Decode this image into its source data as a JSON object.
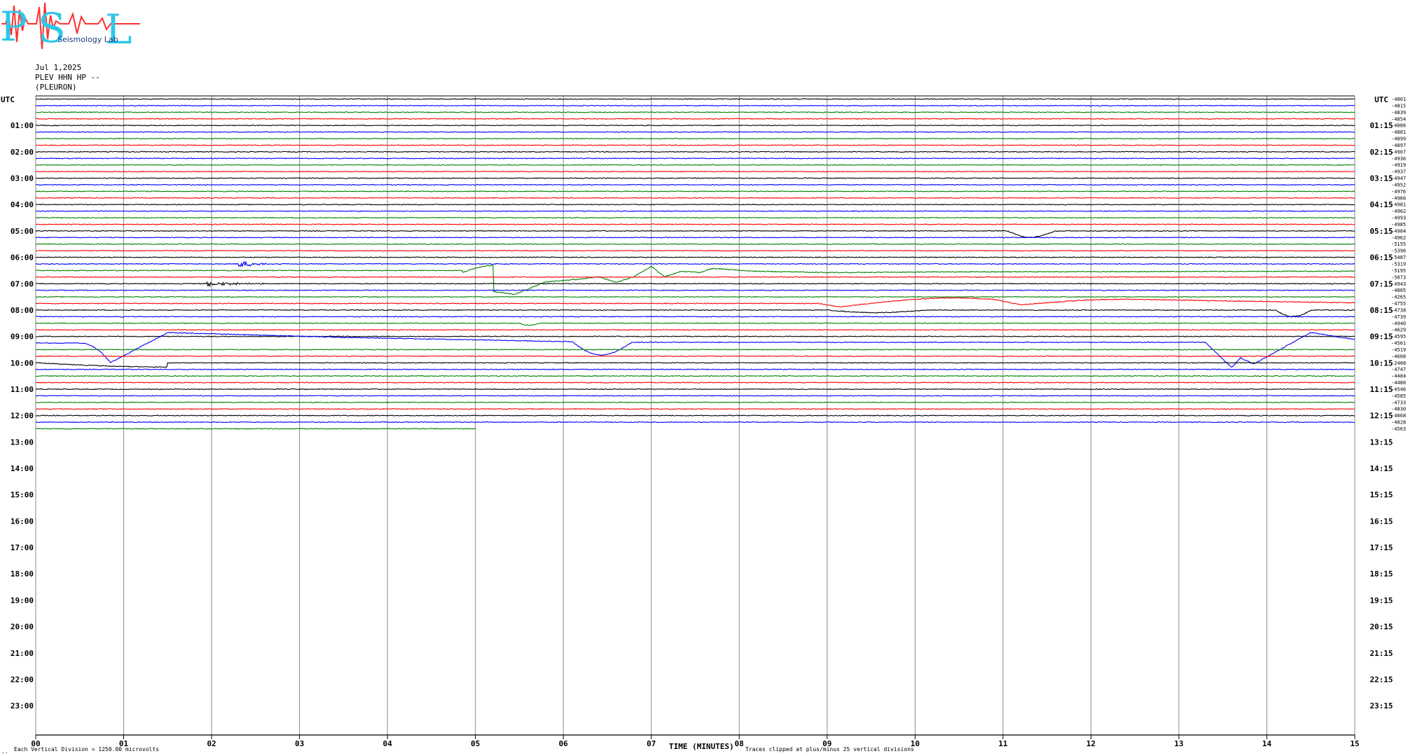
{
  "header": {
    "logo_text": "PSL",
    "logo_subtitle": "Seismology Lab",
    "date": "Jul 1,2025",
    "channel": "PLEV HHN HP --",
    "station": "(PLEURON)"
  },
  "footer": {
    "scale_note": "Each Vertical Division = 1250.00 microvolts",
    "clip_note": "Traces clipped at plus/minus 25 vertical divisions",
    "corner_mark": ".."
  },
  "chart_data": {
    "type": "line",
    "title": "",
    "xlabel": "TIME (MINUTES)",
    "ylabel": "UTC",
    "left_axis_label": "UTC",
    "right_axis_label": "UTC",
    "xlim": [
      0,
      15
    ],
    "x_ticks": [
      "00",
      "01",
      "02",
      "03",
      "04",
      "05",
      "06",
      "07",
      "08",
      "09",
      "10",
      "11",
      "12",
      "13",
      "14",
      "15"
    ],
    "row_minutes": 15,
    "hours_total": 24,
    "rows_recorded": 51,
    "last_row_end_minute": 5,
    "left_hour_labels": [
      "01:00",
      "02:00",
      "03:00",
      "04:00",
      "05:00",
      "06:00",
      "07:00",
      "08:00",
      "09:00",
      "10:00",
      "11:00",
      "12:00",
      "13:00",
      "14:00",
      "15:00",
      "16:00",
      "17:00",
      "18:00",
      "19:00",
      "20:00",
      "21:00",
      "22:00",
      "23:00"
    ],
    "right_hour_labels": [
      "01:15",
      "02:15",
      "03:15",
      "04:15",
      "05:15",
      "06:15",
      "07:15",
      "08:15",
      "09:15",
      "10:15",
      "11:15",
      "12:15",
      "13:15",
      "14:15",
      "15:15",
      "16:15",
      "17:15",
      "18:15",
      "19:15",
      "20:15",
      "21:15",
      "22:15",
      "23:15"
    ],
    "row_colors": [
      "#000000",
      "#0000ff",
      "#008000",
      "#ff0000"
    ],
    "row_offsets": [
      "-4801",
      "-4815",
      "-4839",
      "-4854",
      "-4886",
      "-4881",
      "-4899",
      "-4897",
      "-4907",
      "-4936",
      "-4919",
      "-4937",
      "-4947",
      "-4952",
      "-4976",
      "-4966",
      "-4981",
      "-4962",
      "-4993",
      "-4985",
      "-4984",
      "-4962",
      "-5155",
      "-5396",
      "-5487",
      "-5319",
      "-5195",
      "-5073",
      "-4943",
      "-4805",
      "-4265",
      "-4755",
      "-4738",
      "-4739",
      "-4940",
      "-4629",
      "-4595",
      "-4561",
      "-4519",
      "-4608",
      "-2408",
      "-4747",
      "-4484",
      "-4480",
      "-4546",
      "-4585",
      "-4733",
      "-4830",
      "-4868",
      "-4828",
      "-4563"
    ],
    "events": [
      {
        "row": 20,
        "start_min": 11.05,
        "type": "dip",
        "depth": 10,
        "duration": 1.2
      },
      {
        "row": 25,
        "start_min": 2.3,
        "type": "burst",
        "amplitude": 6,
        "duration": 0.5
      },
      {
        "row": 26,
        "start_min": 4.85,
        "type": "excursion",
        "shape": "blue-wander"
      },
      {
        "row": 28,
        "start_min": 1.95,
        "type": "burst",
        "amplitude": 4,
        "duration": 0.8
      },
      {
        "row": 31,
        "start_min": 8.9,
        "type": "excursion",
        "shape": "red-arc"
      },
      {
        "row": 32,
        "start_min": 9.0,
        "type": "dip",
        "depth": 4,
        "duration": 2.5
      },
      {
        "row": 32,
        "start_min": 14.1,
        "type": "dip",
        "depth": 10,
        "duration": 0.9
      },
      {
        "row": 34,
        "start_min": 5.5,
        "type": "dip",
        "depth": 3,
        "duration": 0.5
      },
      {
        "row": 37,
        "start_min": 0.5,
        "type": "excursion",
        "shape": "red-drop"
      },
      {
        "row": 37,
        "start_min": 6.1,
        "type": "dip",
        "depth": 20,
        "duration": 1.5
      },
      {
        "row": 37,
        "start_min": 13.3,
        "type": "excursion",
        "shape": "red-drop2"
      },
      {
        "row": 40,
        "start_min": 0.0,
        "type": "drift",
        "depth": 6,
        "duration": 1.5
      }
    ]
  }
}
